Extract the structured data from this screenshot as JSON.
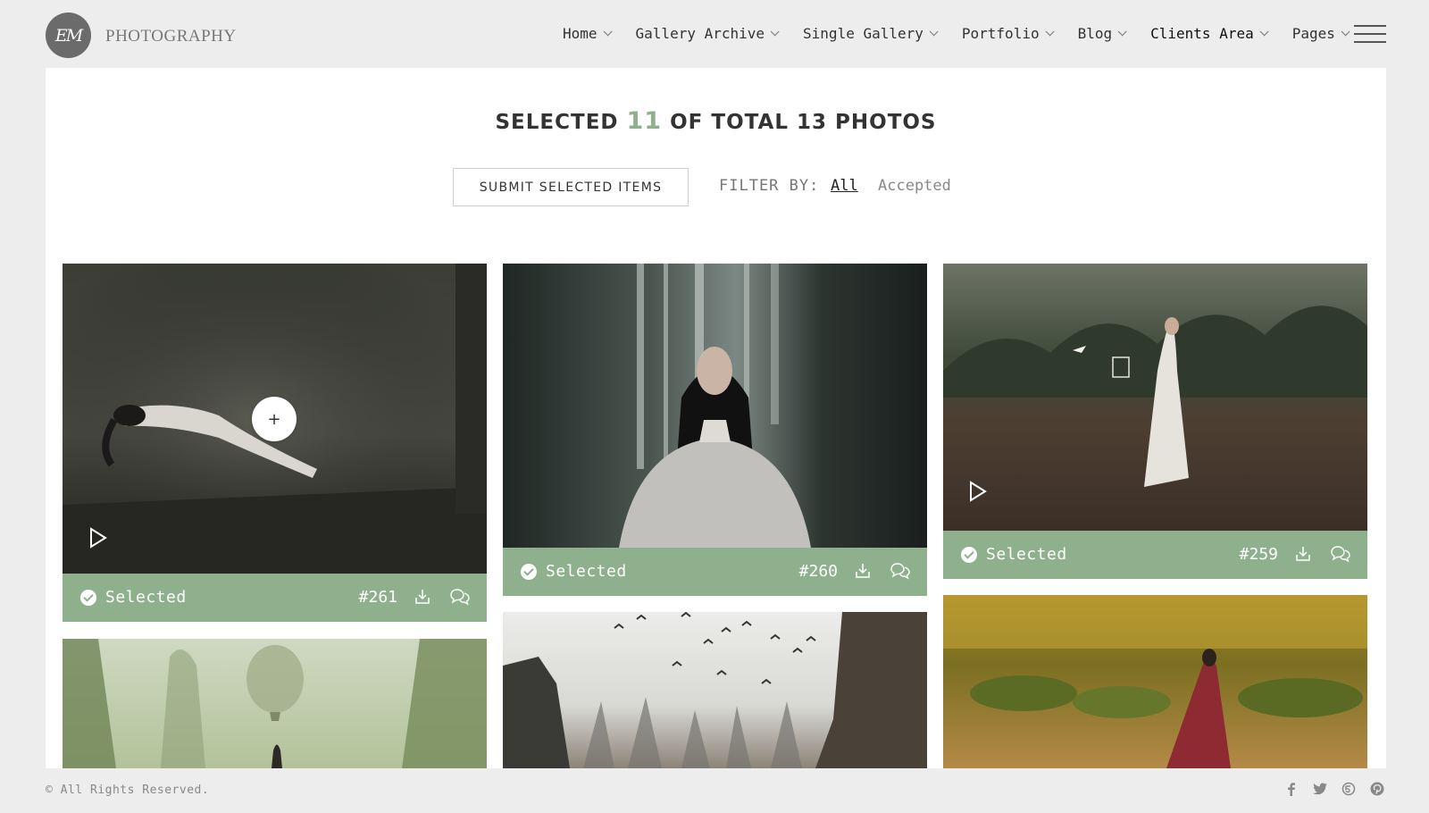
{
  "brand": {
    "monogram": "EM",
    "name": "PHOTOGRAPHY"
  },
  "nav": [
    {
      "label": "Home"
    },
    {
      "label": "Gallery Archive"
    },
    {
      "label": "Single Gallery"
    },
    {
      "label": "Portfolio"
    },
    {
      "label": "Blog"
    },
    {
      "label": "Clients Area"
    },
    {
      "label": "Pages"
    }
  ],
  "heading": {
    "prefix": "SELECTED",
    "selected": "11",
    "middle": "OF TOTAL",
    "total": "13",
    "suffix": "PHOTOS"
  },
  "actions": {
    "submit_label": "SUBMIT SELECTED ITEMS"
  },
  "filter": {
    "label": "FILTER BY:",
    "options": [
      "All",
      "Accepted"
    ],
    "active": "All"
  },
  "cards": [
    {
      "status": "Selected",
      "id": "#261",
      "has_video": true,
      "hover_plus": "+"
    },
    {
      "status": "Selected",
      "id": "#260",
      "has_video": false
    },
    {
      "status": "Selected",
      "id": "#259",
      "has_video": true
    }
  ],
  "footer": {
    "copyright": "© All Rights Reserved."
  },
  "socials": [
    "facebook-icon",
    "twitter-icon",
    "500px-icon",
    "pinterest-icon"
  ],
  "colors": {
    "accent": "#8fb08d",
    "background": "#ededed",
    "panel": "#ffffff"
  }
}
